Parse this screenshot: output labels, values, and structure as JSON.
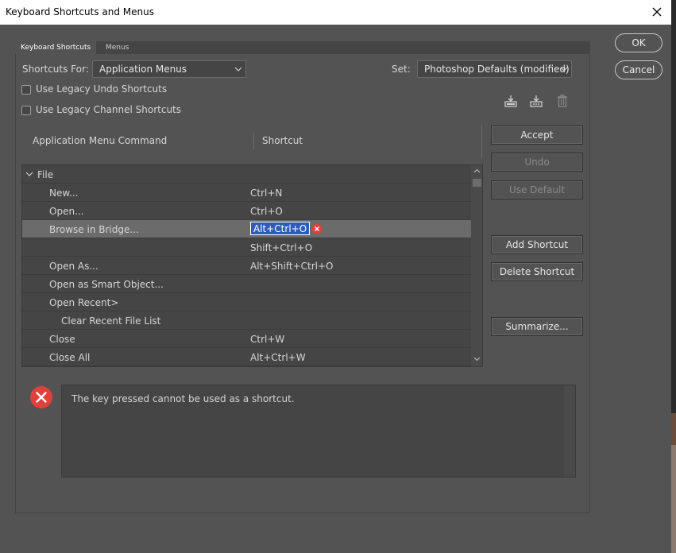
{
  "window": {
    "title": "Keyboard Shortcuts and Menus"
  },
  "tabs": [
    {
      "label": "Keyboard Shortcuts"
    },
    {
      "label": "Menus"
    }
  ],
  "shortcuts_for": {
    "label": "Shortcuts For:",
    "value": "Application Menus"
  },
  "set": {
    "label": "Set:",
    "value": "Photoshop Defaults (modified)"
  },
  "checkboxes": {
    "legacy_undo": "Use Legacy Undo Shortcuts",
    "legacy_channel": "Use Legacy Channel Shortcuts"
  },
  "columns": {
    "command": "Application Menu Command",
    "shortcut": "Shortcut"
  },
  "group": {
    "label": "File"
  },
  "rows": [
    {
      "command": "New...",
      "shortcut": "Ctrl+N"
    },
    {
      "command": "Open...",
      "shortcut": "Ctrl+O"
    },
    {
      "command": "Browse in Bridge...",
      "shortcut": "Alt+Ctrl+O"
    },
    {
      "command": "",
      "shortcut": "Shift+Ctrl+O"
    },
    {
      "command": "Open As...",
      "shortcut": "Alt+Shift+Ctrl+O"
    },
    {
      "command": "Open as Smart Object...",
      "shortcut": ""
    },
    {
      "command": "Open Recent>",
      "shortcut": ""
    },
    {
      "command": "Clear Recent File List",
      "shortcut": ""
    },
    {
      "command": "Close",
      "shortcut": "Ctrl+W"
    },
    {
      "command": "Close All",
      "shortcut": "Alt+Ctrl+W"
    }
  ],
  "buttons": {
    "ok": "OK",
    "cancel": "Cancel",
    "accept": "Accept",
    "undo": "Undo",
    "use_default": "Use Default",
    "add_shortcut": "Add Shortcut",
    "delete_shortcut": "Delete Shortcut",
    "summarize": "Summarize..."
  },
  "message": {
    "text": "The key pressed cannot be used as a shortcut."
  },
  "colors": {
    "error": "#e0403c",
    "selection": "#2e5db8"
  }
}
